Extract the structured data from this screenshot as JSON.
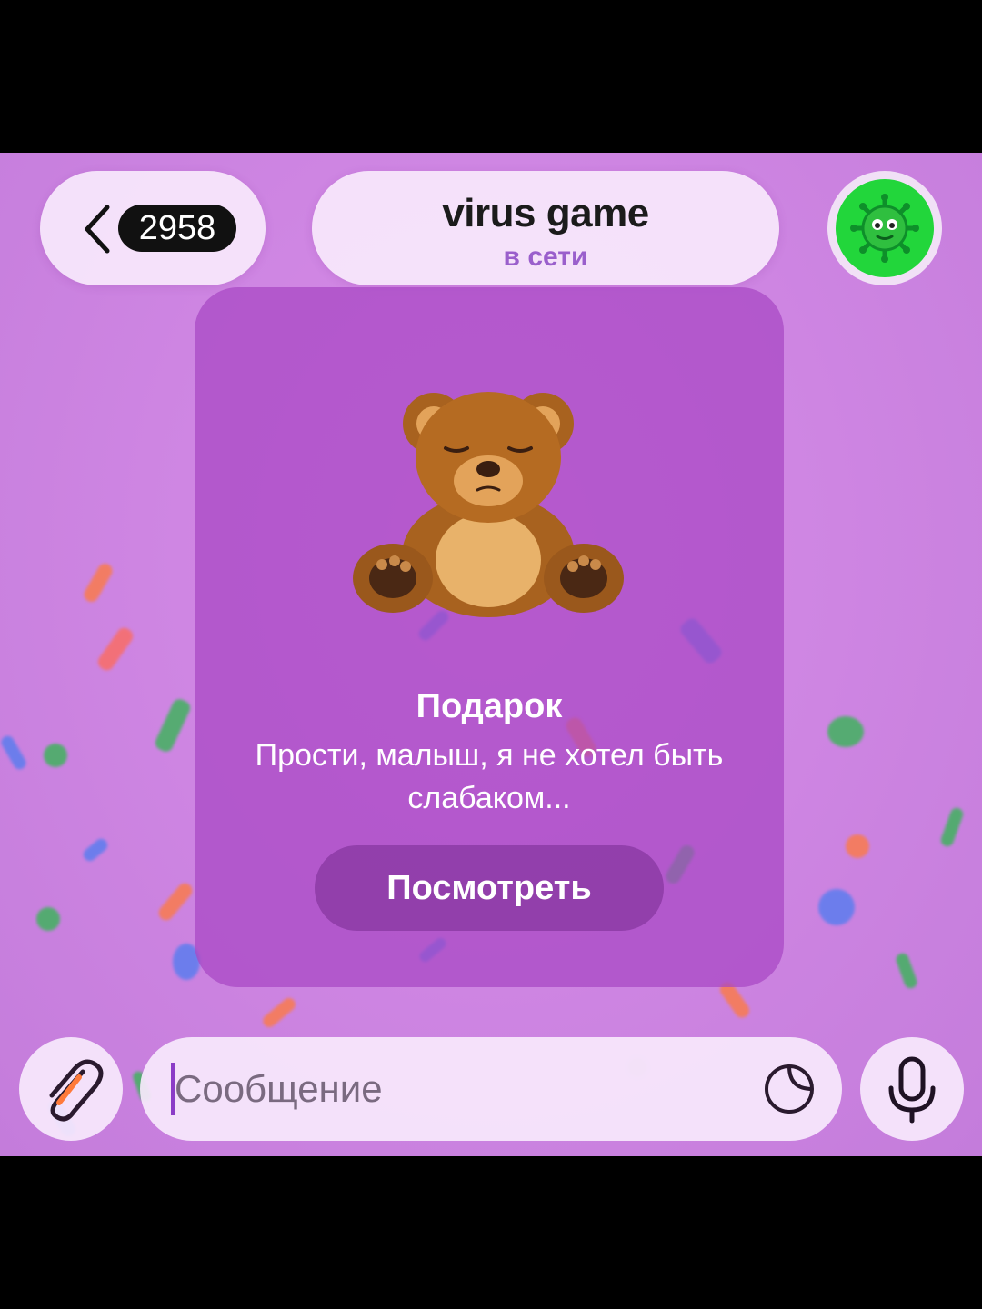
{
  "header": {
    "unread_count": "2958",
    "chat_name": "virus game",
    "chat_status": "в сети",
    "avatar_icon": "virus-emoji-icon",
    "avatar_color": "#22d63b"
  },
  "gift": {
    "icon": "teddy-bear-icon",
    "title": "Подарок",
    "message": "Прости, малыш, я не хотел быть слабаком...",
    "button_label": "Посмотреть"
  },
  "composer": {
    "placeholder": "Сообщение",
    "attach_icon": "paperclip-icon",
    "sticker_icon": "sticker-icon",
    "mic_icon": "microphone-icon"
  },
  "colors": {
    "background": "#cf86e3",
    "card": "#a846c4",
    "accent": "#9a5fcc"
  }
}
